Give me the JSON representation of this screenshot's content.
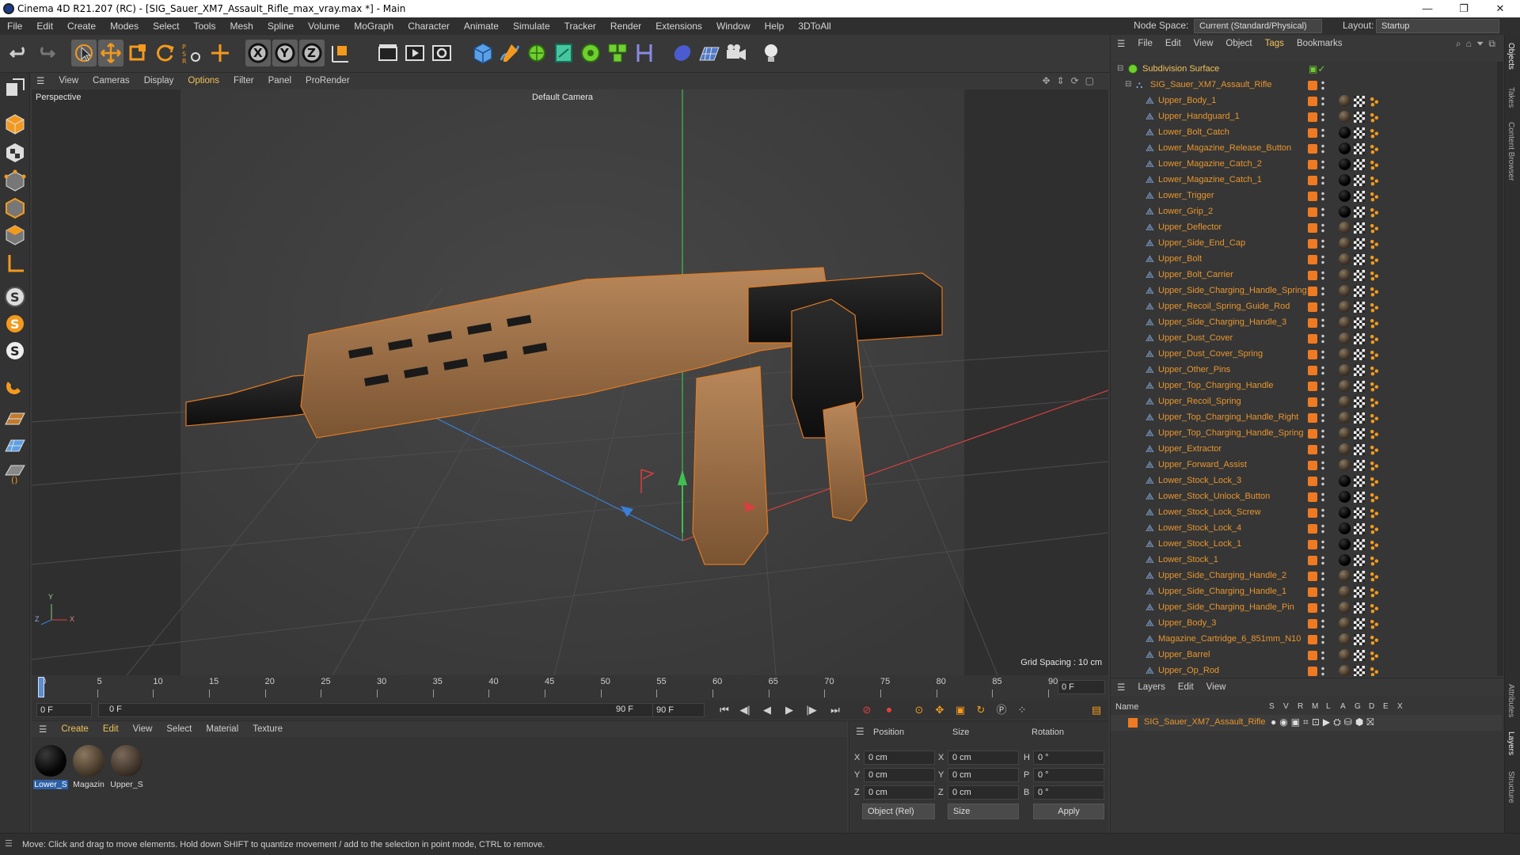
{
  "window": {
    "title": "Cinema 4D R21.207 (RC) - [SIG_Sauer_XM7_Assault_Rifle_max_vray.max *] - Main",
    "controls": [
      "—",
      "❐",
      "✕"
    ]
  },
  "menu": {
    "items": [
      "File",
      "Edit",
      "Create",
      "Modes",
      "Select",
      "Tools",
      "Mesh",
      "Spline",
      "Volume",
      "MoGraph",
      "Character",
      "Animate",
      "Simulate",
      "Tracker",
      "Render",
      "Extensions",
      "Window",
      "Help",
      "3DToAll"
    ],
    "node_space_label": "Node Space:",
    "node_space_value": "Current (Standard/Physical)",
    "layout_label": "Layout:",
    "layout_value": "Startup"
  },
  "viewport": {
    "menu": [
      "View",
      "Cameras",
      "Display",
      "Options",
      "Filter",
      "Panel",
      "ProRender"
    ],
    "view_name": "Perspective",
    "camera": "Default Camera",
    "grid_spacing": "Grid Spacing : 10 cm",
    "axis_x": "X",
    "axis_y": "Y",
    "axis_z": "Z"
  },
  "timeline": {
    "ticks": [
      "0",
      "5",
      "10",
      "15",
      "20",
      "25",
      "30",
      "35",
      "40",
      "45",
      "50",
      "55",
      "60",
      "65",
      "70",
      "75",
      "80",
      "85",
      "90"
    ],
    "current_frame_right": "0 F",
    "start_frame": "0 F",
    "range_start": "0 F",
    "range_end": "90 F",
    "end_frame": "90 F"
  },
  "materials": {
    "menu": [
      "Create",
      "Edit",
      "View",
      "Select",
      "Material",
      "Texture"
    ],
    "items": [
      {
        "name": "Lower_S",
        "color": "#050505"
      },
      {
        "name": "Magazin",
        "color": "#5a4a38"
      },
      {
        "name": "Upper_S",
        "color": "#4d4035"
      }
    ]
  },
  "coords": {
    "headers": [
      "Position",
      "Size",
      "Rotation"
    ],
    "rows": [
      {
        "axis": "X",
        "pos": "0 cm",
        "size_axis": "X",
        "size": "0 cm",
        "rot_axis": "H",
        "rot": "0 °"
      },
      {
        "axis": "Y",
        "pos": "0 cm",
        "size_axis": "Y",
        "size": "0 cm",
        "rot_axis": "P",
        "rot": "0 °"
      },
      {
        "axis": "Z",
        "pos": "0 cm",
        "size_axis": "Z",
        "size": "0 cm",
        "rot_axis": "B",
        "rot": "0 °"
      }
    ],
    "mode": "Object (Rel)",
    "size_mode": "Size",
    "apply": "Apply"
  },
  "objects": {
    "menu": [
      "File",
      "Edit",
      "View",
      "Object",
      "Tags",
      "Bookmarks"
    ],
    "root": "Subdivision Surface",
    "group": "SIG_Sauer_XM7_Assault_Rifle",
    "items": [
      {
        "name": "Upper_Body_1",
        "mat": "brown"
      },
      {
        "name": "Upper_Handguard_1",
        "mat": "brown"
      },
      {
        "name": "Lower_Bolt_Catch",
        "mat": "black"
      },
      {
        "name": "Lower_Magazine_Release_Button",
        "mat": "black"
      },
      {
        "name": "Lower_Magazine_Catch_2",
        "mat": "black"
      },
      {
        "name": "Lower_Magazine_Catch_1",
        "mat": "black"
      },
      {
        "name": "Lower_Trigger",
        "mat": "black"
      },
      {
        "name": "Lower_Grip_2",
        "mat": "black"
      },
      {
        "name": "Upper_Deflector",
        "mat": "brown"
      },
      {
        "name": "Upper_Side_End_Cap",
        "mat": "brown"
      },
      {
        "name": "Upper_Bolt",
        "mat": "brown"
      },
      {
        "name": "Upper_Bolt_Carrier",
        "mat": "brown"
      },
      {
        "name": "Upper_Side_Charging_Handle_Spring",
        "mat": "brown"
      },
      {
        "name": "Upper_Recoil_Spring_Guide_Rod",
        "mat": "brown"
      },
      {
        "name": "Upper_Side_Charging_Handle_3",
        "mat": "brown"
      },
      {
        "name": "Upper_Dust_Cover",
        "mat": "brown"
      },
      {
        "name": "Upper_Dust_Cover_Spring",
        "mat": "brown"
      },
      {
        "name": "Upper_Other_Pins",
        "mat": "brown"
      },
      {
        "name": "Upper_Top_Charging_Handle",
        "mat": "brown"
      },
      {
        "name": "Upper_Recoil_Spring",
        "mat": "brown"
      },
      {
        "name": "Upper_Top_Charging_Handle_Right",
        "mat": "brown"
      },
      {
        "name": "Upper_Top_Charging_Handle_Spring",
        "mat": "brown"
      },
      {
        "name": "Upper_Extractor",
        "mat": "brown"
      },
      {
        "name": "Upper_Forward_Assist",
        "mat": "brown"
      },
      {
        "name": "Lower_Stock_Lock_3",
        "mat": "black"
      },
      {
        "name": "Lower_Stock_Unlock_Button",
        "mat": "black"
      },
      {
        "name": "Lower_Stock_Lock_Screw",
        "mat": "black"
      },
      {
        "name": "Lower_Stock_Lock_4",
        "mat": "black"
      },
      {
        "name": "Lower_Stock_Lock_1",
        "mat": "black"
      },
      {
        "name": "Lower_Stock_1",
        "mat": "black"
      },
      {
        "name": "Upper_Side_Charging_Handle_2",
        "mat": "brown"
      },
      {
        "name": "Upper_Side_Charging_Handle_1",
        "mat": "brown"
      },
      {
        "name": "Upper_Side_Charging_Handle_Pin",
        "mat": "brown"
      },
      {
        "name": "Upper_Body_3",
        "mat": "brown"
      },
      {
        "name": "Magazine_Cartridge_6_851mm_N10",
        "mat": "brown"
      },
      {
        "name": "Upper_Barrel",
        "mat": "brown"
      },
      {
        "name": "Upper_Op_Rod",
        "mat": "brown"
      }
    ]
  },
  "layers": {
    "menu": [
      "Layers",
      "Edit",
      "View"
    ],
    "name_header": "Name",
    "flags": [
      "S",
      "V",
      "R",
      "M",
      "L",
      "A",
      "G",
      "D",
      "E",
      "X"
    ],
    "layer": "SIG_Sauer_XM7_Assault_Rifle"
  },
  "right_tabs": [
    "Objects",
    "Takes",
    "Content Browser",
    "Attributes",
    "Layers",
    "Structure"
  ],
  "status": "Move: Click and drag to move elements. Hold down SHIFT to quantize movement / add to the selection in point mode, CTRL to remove.",
  "colors": {
    "accent": "#f39a1e",
    "object_text": "#e8962e",
    "root_text": "#f0c25a"
  }
}
